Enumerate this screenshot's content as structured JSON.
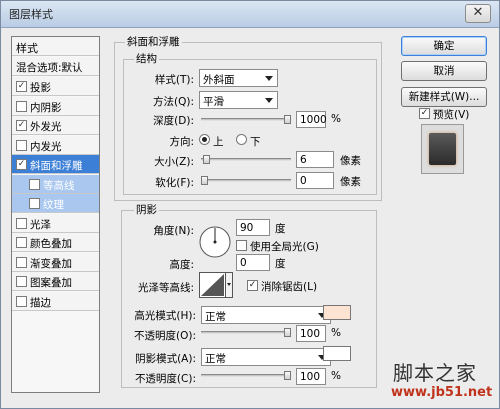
{
  "window": {
    "title": "图层样式",
    "close": "✕"
  },
  "sidebar": {
    "header": "样式",
    "blend_default": "混合选项:默认",
    "items": [
      {
        "label": "投影",
        "checked": true
      },
      {
        "label": "内阴影",
        "checked": false
      },
      {
        "label": "外发光",
        "checked": true
      },
      {
        "label": "内发光",
        "checked": false
      },
      {
        "label": "斜面和浮雕",
        "checked": true
      },
      {
        "label": "等高线",
        "checked": false
      },
      {
        "label": "纹理",
        "checked": false
      },
      {
        "label": "光泽",
        "checked": false
      },
      {
        "label": "颜色叠加",
        "checked": false
      },
      {
        "label": "渐变叠加",
        "checked": false
      },
      {
        "label": "图案叠加",
        "checked": false
      },
      {
        "label": "描边",
        "checked": false
      }
    ]
  },
  "bevel": {
    "group_title": "斜面和浮雕",
    "structure_title": "结构",
    "style_label": "样式(T):",
    "style_value": "外斜面",
    "technique_label": "方法(Q):",
    "technique_value": "平滑",
    "depth_label": "深度(D):",
    "depth_value": "1000",
    "depth_unit": "%",
    "depth_level": 1.0,
    "direction_label": "方向:",
    "direction_up": "上",
    "direction_down": "下",
    "size_label": "大小(Z):",
    "size_value": "6",
    "size_unit": "像素",
    "size_level": 0.02,
    "soften_label": "软化(F):",
    "soften_value": "0",
    "soften_unit": "像素",
    "soften_level": 0.0
  },
  "shading": {
    "title": "阴影",
    "angle_label": "角度(N):",
    "angle_value": "90",
    "angle_unit": "度",
    "global_light": "使用全局光(G)",
    "altitude_label": "高度:",
    "altitude_value": "0",
    "altitude_unit": "度",
    "gloss_label": "光泽等高线:",
    "antialias": "消除锯齿(L)",
    "highlight_label": "高光模式(H):",
    "highlight_value": "正常",
    "highlight_color": "#fde3d2",
    "highlight_opacity_label": "不透明度(O):",
    "highlight_opacity": "100",
    "highlight_opacity_unit": "%",
    "shadow_label": "阴影模式(A):",
    "shadow_value": "正常",
    "shadow_color": "#ffffff",
    "shadow_opacity_label": "不透明度(C):",
    "shadow_opacity": "100",
    "shadow_opacity_unit": "%"
  },
  "buttons": {
    "ok": "确定",
    "cancel": "取消",
    "new_style": "新建样式(W)...",
    "preview": "预览(V)"
  },
  "watermark": {
    "line1": "脚本之家",
    "line2": "www.jb51.net"
  }
}
